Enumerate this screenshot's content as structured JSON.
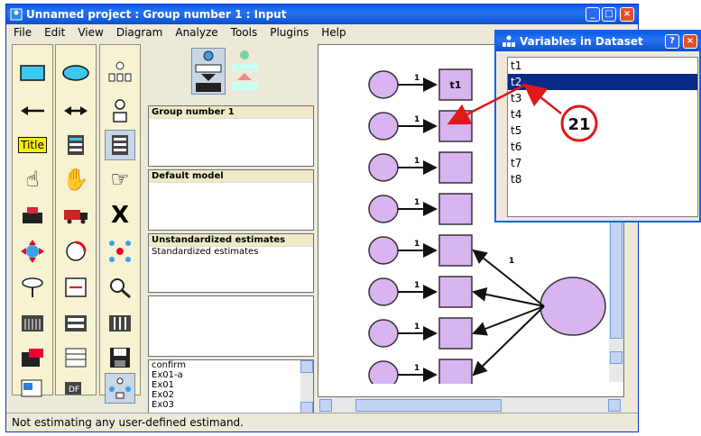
{
  "window": {
    "title": "Unnamed project : Group number 1 : Input",
    "controls": [
      "minimize-icon",
      "maximize-icon",
      "close-icon"
    ]
  },
  "menu": [
    "File",
    "Edit",
    "View",
    "Diagram",
    "Analyze",
    "Tools",
    "Plugins",
    "Help"
  ],
  "toolbox": {
    "title_tool_label": "Title"
  },
  "panels": {
    "group": {
      "header": "Group number 1"
    },
    "model": {
      "header": "Default model"
    },
    "estimates": {
      "items": [
        "Unstandardized estimates",
        "Standardized estimates"
      ]
    },
    "files": {
      "items": [
        "confirm",
        "Ex01-a",
        "Ex01",
        "Ex02",
        "Ex03"
      ]
    }
  },
  "diagram": {
    "observed": [
      "t1",
      "",
      "",
      "",
      "",
      "",
      "",
      ""
    ],
    "path_coefficient": "1",
    "factor_loading": "1"
  },
  "dialog": {
    "title": "Variables in Dataset",
    "variables": [
      "t1",
      "t2",
      "t3",
      "t4",
      "t5",
      "t6",
      "t7",
      "t8"
    ],
    "selected": "t2",
    "callout": "21"
  },
  "status": "Not estimating any user-defined estimand.",
  "colors": {
    "title_blue": "#0a5ee8",
    "node_fill": "#d8b4f0",
    "callout_red": "#e01818",
    "selection": "#0a2a86"
  }
}
